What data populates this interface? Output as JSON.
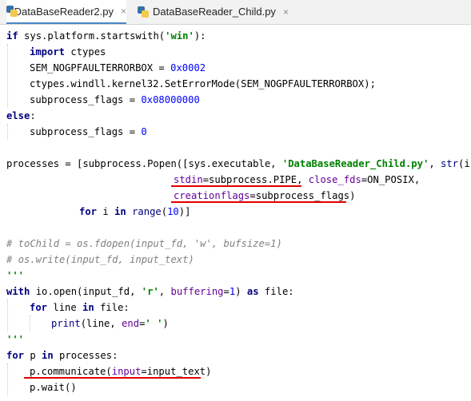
{
  "tabs": [
    {
      "label": "DataBaseReader2.py",
      "close": "×"
    },
    {
      "label": "DataBaseReader_Child.py",
      "close": "×"
    }
  ],
  "code": {
    "l1": [
      "if",
      " sys.platform.startswith(",
      "'win'",
      "):"
    ],
    "l2": [
      "import",
      " ctypes"
    ],
    "l3": [
      "SEM_NOGPFAULTERRORBOX = ",
      "0x0002"
    ],
    "l4": [
      "ctypes.windll.kernel32.SetErrorMode(SEM_NOGPFAULTERRORBOX);"
    ],
    "l5": [
      "subprocess_flags = ",
      "0x08000000"
    ],
    "l6": [
      "else",
      ":"
    ],
    "l7": [
      "subprocess_flags = ",
      "0"
    ],
    "l8": [
      "processes = [subprocess.Popen([sys.executable, ",
      "'DataBaseReader_Child.py'",
      ", ",
      "str",
      "(i)],"
    ],
    "l9": [
      "stdin",
      "=subprocess.PIPE, ",
      "close_fds",
      "=ON_POSIX,"
    ],
    "l10": [
      "creationflags",
      "=subprocess_flags)"
    ],
    "l11": [
      "for",
      " i ",
      "in",
      " ",
      "range",
      "(",
      "10",
      ")]"
    ],
    "l12": [
      "# toChild = os.fdopen(input_fd, 'w', bufsize=1)"
    ],
    "l13": [
      "# os.write(input_fd, input_text)"
    ],
    "l14": [
      "'''"
    ],
    "l15": [
      "with",
      " io.open(input_fd, ",
      "'r'",
      ", ",
      "buffering",
      "=",
      "1",
      ") ",
      "as",
      " file:"
    ],
    "l16": [
      "for",
      " line ",
      "in",
      " file:"
    ],
    "l17": [
      "print",
      "(line, ",
      "end",
      "=",
      "' '",
      ")"
    ],
    "l18": [
      "'''"
    ],
    "l19": [
      "for",
      " p ",
      "in",
      " processes:"
    ],
    "l20": [
      "p.communicate(",
      "input",
      "=input_text)"
    ],
    "l21": [
      "p.wait()"
    ]
  },
  "colors": {
    "keyword": "#000080",
    "string": "#008000",
    "number": "#0000ff",
    "comment": "#808080",
    "param": "#660099",
    "annotation_underline": "#e00000"
  }
}
